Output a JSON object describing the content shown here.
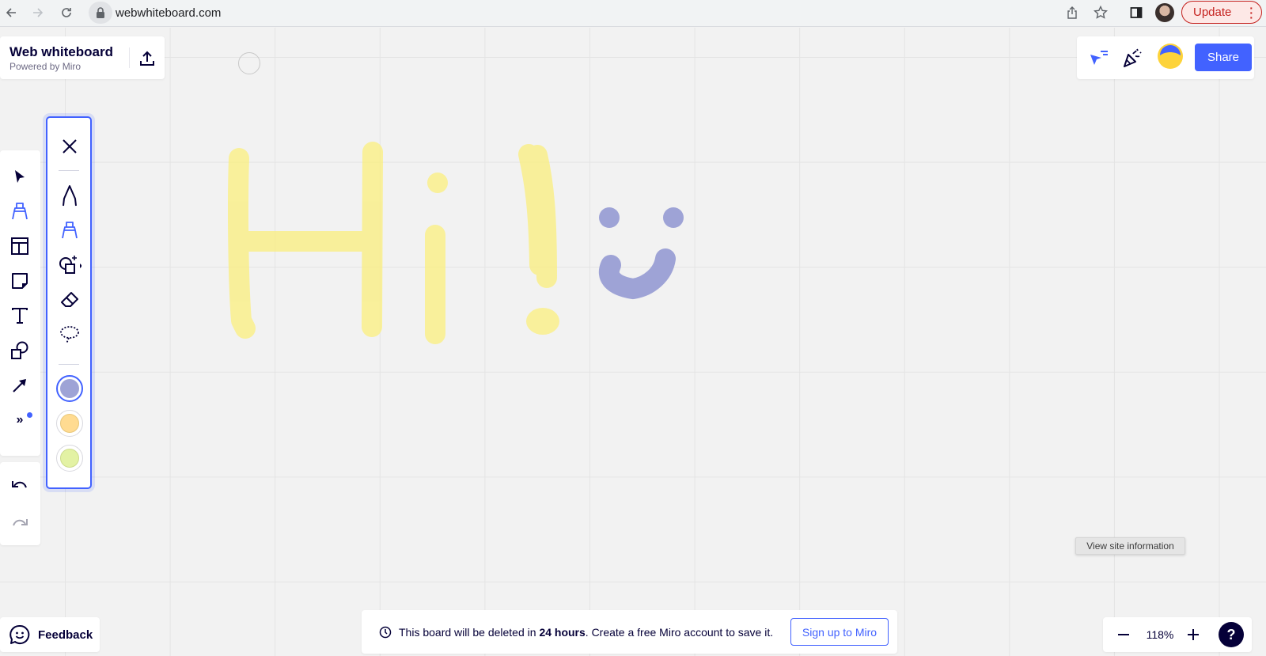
{
  "browser": {
    "url": "webwhiteboard.com",
    "update_label": "Update",
    "icons": [
      "back-icon",
      "forward-icon",
      "reload-icon",
      "lock-icon",
      "share-page-icon",
      "bookmark-star-icon",
      "side-panel-icon",
      "profile-avatar",
      "more-vert-icon"
    ]
  },
  "board": {
    "title": "Web whiteboard",
    "subtitle": "Powered by Miro"
  },
  "top_right": {
    "share_label": "Share",
    "icons": [
      "follow-cursor-icon",
      "celebrate-icon",
      "user-avatar-icon"
    ]
  },
  "toolbar": {
    "tools": [
      {
        "name": "select",
        "icon": "cursor-icon"
      },
      {
        "name": "pen",
        "icon": "marker-icon",
        "active": true
      },
      {
        "name": "templates",
        "icon": "layout-icon"
      },
      {
        "name": "sticky-note",
        "icon": "sticky-note-icon"
      },
      {
        "name": "text",
        "icon": "text-icon"
      },
      {
        "name": "shapes",
        "icon": "shapes-icon"
      },
      {
        "name": "connector",
        "icon": "arrow-icon"
      },
      {
        "name": "more",
        "icon": "more-tools-icon"
      }
    ],
    "undo": "undo-icon",
    "redo": "redo-icon"
  },
  "pen_panel": {
    "tools": [
      "close-icon",
      "pen-icon",
      "highlighter-icon",
      "smart-draw-icon",
      "eraser-icon",
      "lasso-icon"
    ],
    "colors": [
      {
        "hex": "#9ea3d6",
        "selected": true
      },
      {
        "hex": "#ffdb91",
        "selected": false
      },
      {
        "hex": "#e3f2a4",
        "selected": false
      }
    ]
  },
  "drawing": {
    "text": "Hi! :)",
    "highlight_color": "#fbf17a",
    "smiley_color": "#9ea3d6"
  },
  "notice": {
    "prefix": "This board will be deleted in ",
    "bold": "24 hours",
    "suffix": ". Create a free Miro account to save it.",
    "signup_label": "Sign up to Miro"
  },
  "feedback": {
    "label": "Feedback"
  },
  "zoom": {
    "value": "118%",
    "help_label": "?"
  },
  "tooltip": {
    "text": "View site information"
  }
}
